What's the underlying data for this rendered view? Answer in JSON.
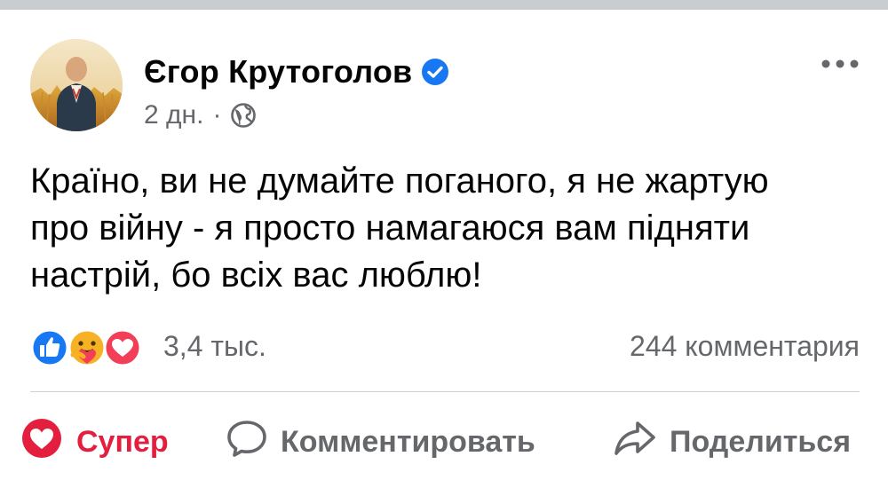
{
  "post": {
    "author": "Єгор Крутоголов",
    "verified": true,
    "time": "2 дн.",
    "separator": "·",
    "audience_icon": "globe-icon",
    "text": "Країно, ви не думайте поганого, я не жартую\nпро війну - я просто намагаюся вам підняти\nнастрій, бо всіх вас люблю!"
  },
  "reactions": {
    "icons": [
      "like-icon",
      "care-icon",
      "love-icon"
    ],
    "count": "3,4 тыс.",
    "comments": "244 комментария"
  },
  "actions": {
    "super_label": "Супер",
    "comment_label": "Комментировать",
    "share_label": "Поделиться"
  },
  "colors": {
    "like_blue": "#1877f2",
    "love_red": "#f33e58",
    "super_red": "#e41e3f",
    "care_yellow": "#f7b125",
    "secondary_text": "#65676b"
  }
}
